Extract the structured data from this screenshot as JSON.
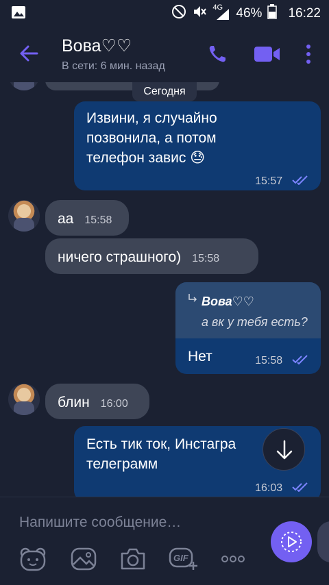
{
  "status_bar": {
    "network": "4G",
    "battery": "46%",
    "time": "16:22"
  },
  "header": {
    "contact_name": "Вова♡♡",
    "status": "В сети: 6 мин. назад"
  },
  "chat": {
    "date_label": "Сегодня",
    "messages": [
      {
        "dir": "out",
        "text_lines": [
          "Извини, я случайно",
          "позвонила, а потом",
          "телефон завис 😓"
        ],
        "time": "15:57"
      },
      {
        "dir": "in",
        "text": "аа",
        "time": "15:58"
      },
      {
        "dir": "in",
        "text": "ничего страшного)",
        "time": "15:58"
      },
      {
        "dir": "out",
        "reply_to_name": "Вова♡♡",
        "reply_to_text": "а вк у тебя есть?",
        "text": "Нет",
        "time": "15:58"
      },
      {
        "dir": "in",
        "text": "блин",
        "time": "16:00"
      },
      {
        "dir": "out",
        "text_lines": [
          "Есть тик ток, Инстагра",
          "телеграмм"
        ],
        "time": "16:03"
      }
    ]
  },
  "composer": {
    "placeholder": "Напишите сообщение…",
    "gif_label": "GIF"
  },
  "colors": {
    "background": "#1b2132",
    "outgoing_bubble": "#0f3a72",
    "incoming_bubble": "#3e4556",
    "accent": "#7360f2"
  }
}
